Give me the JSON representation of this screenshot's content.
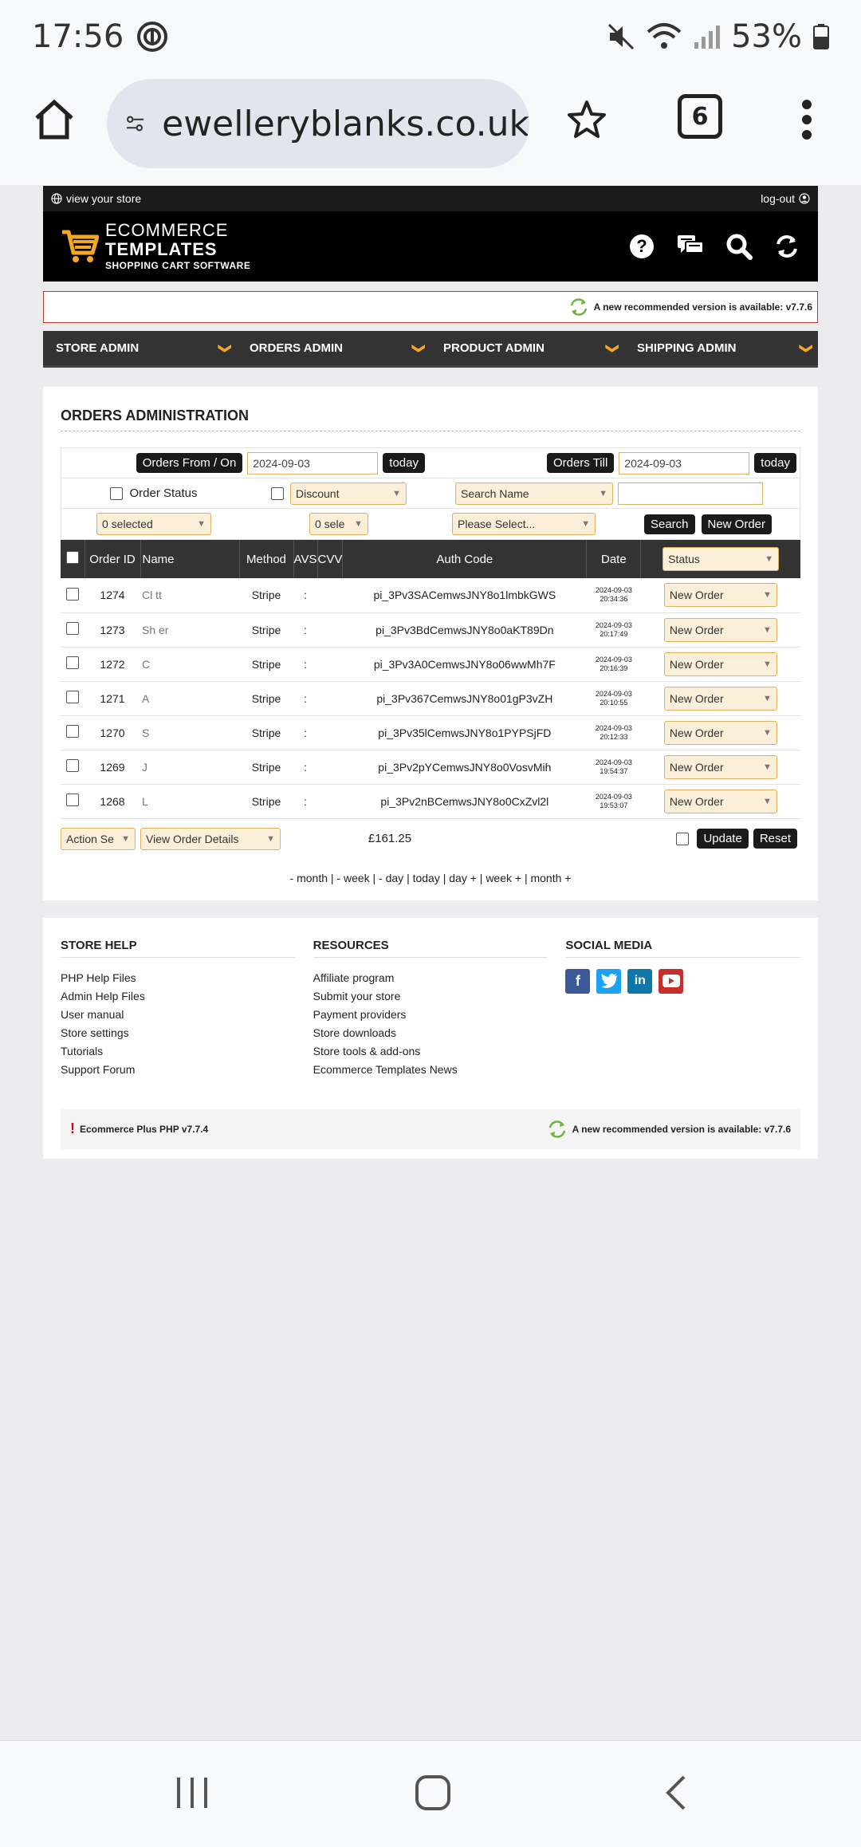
{
  "status_bar": {
    "time": "17:56",
    "battery": "53%"
  },
  "browser": {
    "url": "ewelleryblanks.co.uk",
    "tab_count": "6"
  },
  "store": {
    "view_store": "view your store",
    "logout": "log-out",
    "logo_line1": "ECOMMERCE",
    "logo_line2": "TEMPLATES",
    "logo_line3": "SHOPPING CART SOFTWARE",
    "version_notice": "A new recommended version is available: v7.7.6"
  },
  "menu": [
    {
      "label": "STORE ADMIN"
    },
    {
      "label": "ORDERS ADMIN"
    },
    {
      "label": "PRODUCT ADMIN"
    },
    {
      "label": "SHIPPING ADMIN"
    }
  ],
  "orders": {
    "title": "ORDERS ADMINISTRATION",
    "orders_from_label": "Orders From / On",
    "orders_from_value": "2024-09-03",
    "today_label": "today",
    "orders_till_label": "Orders Till",
    "orders_till_value": "2024-09-03",
    "order_status_label": "Order Status",
    "discount_label": "Discount",
    "search_name_label": "Search Name",
    "selected_1": "0 selected",
    "selected_2": "0 sele",
    "please_select": "Please Select...",
    "search_label": "Search",
    "new_order_label": "New Order",
    "columns": [
      "Order ID",
      "Name",
      "Method",
      "AVS",
      "CVV",
      "Auth Code",
      "Date",
      "Status"
    ],
    "rows": [
      {
        "id": "1274",
        "name": "Cl    tt",
        "method": "Stripe",
        "avs": ":",
        "auth": "pi_3Pv3SACemwsJNY8o1lmbkGWS",
        "date": "2024-09-03",
        "time": "20:34:36",
        "status": "New Order"
      },
      {
        "id": "1273",
        "name": "Sh    er",
        "method": "Stripe",
        "avs": ":",
        "auth": "pi_3Pv3BdCemwsJNY8o0aKT89Dn",
        "date": "2024-09-03",
        "time": "20:17:49",
        "status": "New Order"
      },
      {
        "id": "1272",
        "name": "C",
        "method": "Stripe",
        "avs": ":",
        "auth": "pi_3Pv3A0CemwsJNY8o06wwMh7F",
        "date": "2024-09-03",
        "time": "20:16:39",
        "status": "New Order"
      },
      {
        "id": "1271",
        "name": "A",
        "method": "Stripe",
        "avs": ":",
        "auth": "pi_3Pv367CemwsJNY8o01gP3vZH",
        "date": "2024-09-03",
        "time": "20:10:55",
        "status": "New Order"
      },
      {
        "id": "1270",
        "name": "S",
        "method": "Stripe",
        "avs": ":",
        "auth": "pi_3Pv35lCemwsJNY8o1PYPSjFD",
        "date": "2024-09-03",
        "time": "20:12:33",
        "status": "New Order"
      },
      {
        "id": "1269",
        "name": "J",
        "method": "Stripe",
        "avs": ":",
        "auth": "pi_3Pv2pYCemwsJNY8o0VosvMih",
        "date": "2024-09-03",
        "time": "19:54:37",
        "status": "New Order"
      },
      {
        "id": "1268",
        "name": "L",
        "method": "Stripe",
        "avs": ":",
        "auth": "pi_3Pv2nBCemwsJNY8o0CxZvl2l",
        "date": "2024-09-03",
        "time": "19:53:07",
        "status": "New Order"
      }
    ],
    "action_select": "Action Se",
    "view_details": "View Order Details",
    "total": "£161.25",
    "update_label": "Update",
    "reset_label": "Reset",
    "date_nav": "- month | - week | - day | today | day + | week + | month +"
  },
  "footer": {
    "store_help_title": "STORE HELP",
    "store_help": [
      "PHP Help Files",
      "Admin Help Files",
      "User manual",
      "Store settings",
      "Tutorials",
      "Support Forum"
    ],
    "resources_title": "RESOURCES",
    "resources": [
      "Affiliate program",
      "Submit your store",
      "Payment providers",
      "Store downloads",
      "Store tools & add-ons",
      "Ecommerce Templates News"
    ],
    "social_title": "SOCIAL MEDIA",
    "product_version": "Ecommerce Plus PHP v7.7.4",
    "version_notice": "A new recommended version is available: v7.7.6"
  },
  "colors": {
    "accent": "#f5a623",
    "dark": "#1a1a1a",
    "facebook": "#3b5998",
    "twitter": "#1da1f2",
    "linkedin": "#0e76a8",
    "youtube": "#c4302b"
  }
}
